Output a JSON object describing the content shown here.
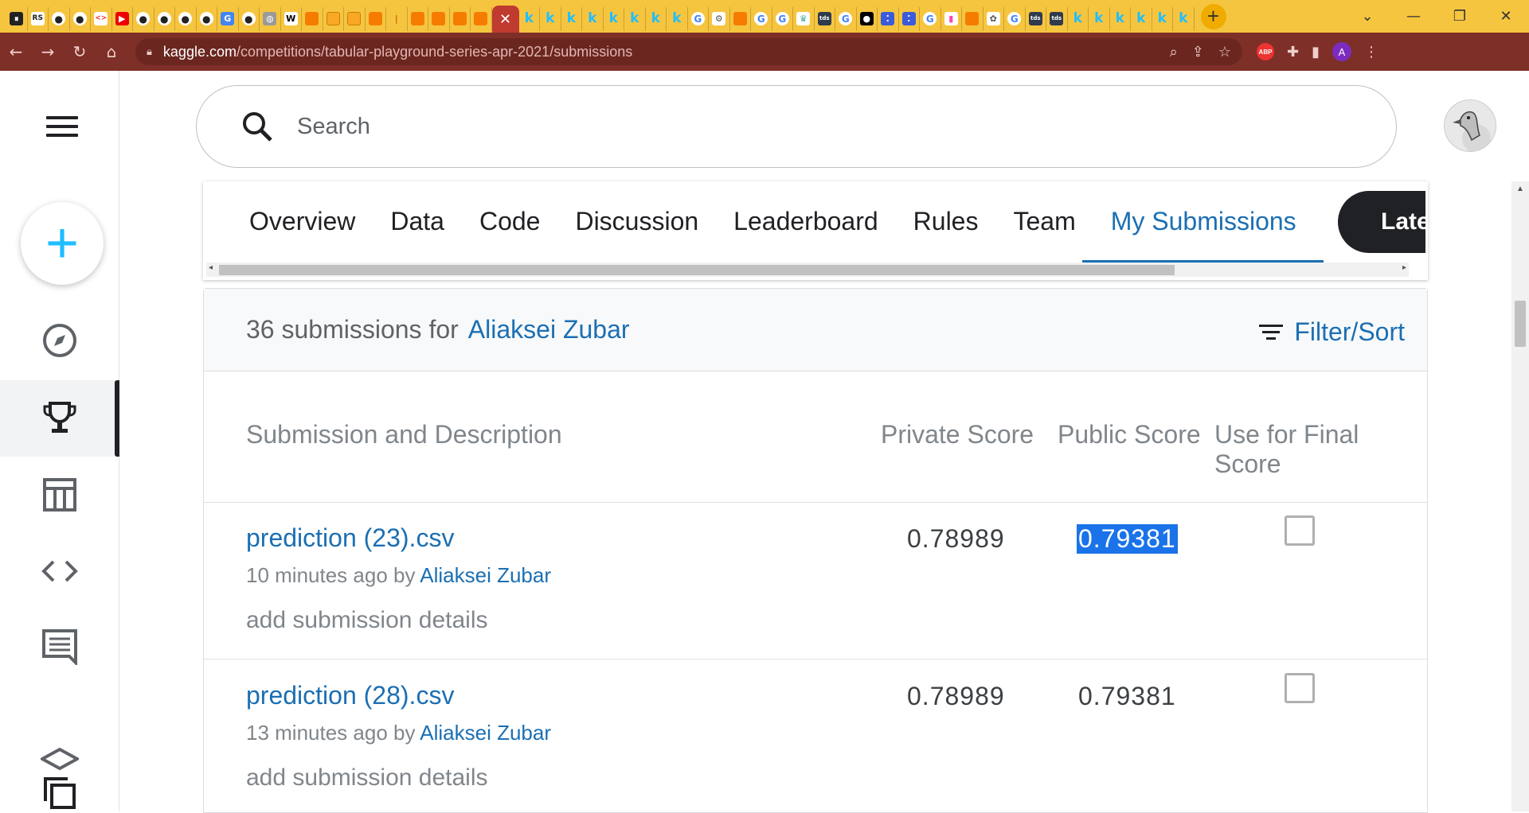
{
  "browser": {
    "url_host": "kaggle.com",
    "url_path": "/competitions/tabular-playground-series-apr-2021/submissions",
    "new_tab_label": "+",
    "active_tab_close": "✕",
    "profile_initial": "A",
    "extension_abp": "ABP"
  },
  "search": {
    "placeholder": "Search"
  },
  "tabs": [
    "Overview",
    "Data",
    "Code",
    "Discussion",
    "Leaderboard",
    "Rules",
    "Team",
    "My Submissions"
  ],
  "late_button": "Late Submission",
  "submissions": {
    "count_text": "36 submissions for",
    "user": "Aliaksei Zubar",
    "filter_label": "Filter/Sort",
    "columns": {
      "description": "Submission and Description",
      "private": "Private Score",
      "public": "Public Score",
      "final_line1": "Use for Final",
      "final_line2": "Score"
    },
    "rows": [
      {
        "file": "prediction (23).csv",
        "time": "10 minutes ago by",
        "by": "Aliaksei Zubar",
        "details": "add submission details",
        "private": "0.78989",
        "public": "0.79381",
        "selected": false
      },
      {
        "file": "prediction (28).csv",
        "time": "13 minutes ago by",
        "by": "Aliaksei Zubar",
        "details": "add submission details",
        "private": "0.78989",
        "public": "0.79381",
        "selected": false
      }
    ]
  },
  "icons": {
    "menu": "hamburger-icon",
    "create": "plus-icon",
    "explore": "compass-icon",
    "competitions": "trophy-icon",
    "datasets": "table-icon",
    "code": "code-icon",
    "discussions": "comment-icon",
    "learn": "school-icon",
    "more": "copy-icon"
  },
  "colors": {
    "kaggle_blue": "#1b6fb3",
    "plus_cyan": "#20beff",
    "tabbar": "#f6c53f",
    "addressbar": "#7e2f28"
  }
}
